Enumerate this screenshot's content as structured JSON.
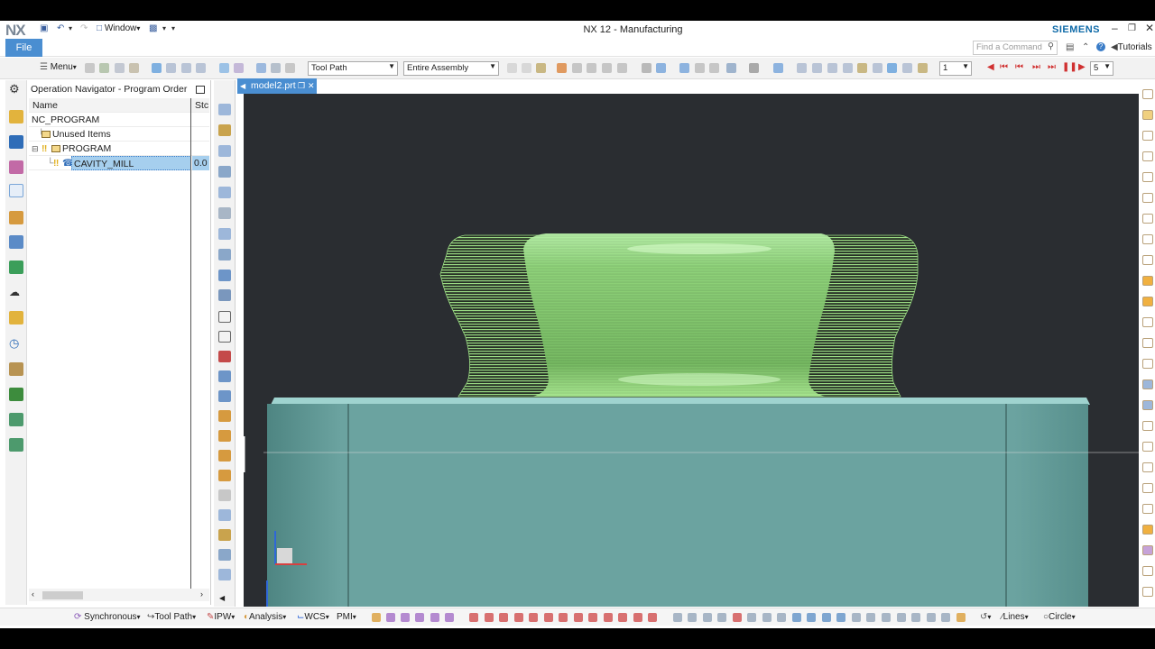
{
  "titlebar": {
    "logo": "NX",
    "window_menu": "Window",
    "title": "NX 12 - Manufacturing",
    "brand": "SIEMENS"
  },
  "ribbon": {
    "file_tab": "File",
    "find_placeholder": "Find a Command",
    "tutorials": "Tutorials"
  },
  "toolbar": {
    "menu_label": "Menu",
    "type_filter": "Tool Path",
    "scope_filter": "Entire Assembly",
    "step_value": "1",
    "speed_value": "5"
  },
  "navigator": {
    "title": "Operation Navigator - Program Order",
    "columns": {
      "name": "Name",
      "status": "Stc"
    },
    "rows": [
      {
        "label": "NC_PROGRAM",
        "status": ""
      },
      {
        "label": "Unused Items",
        "status": ""
      },
      {
        "label": "PROGRAM",
        "status": ""
      },
      {
        "label": "CAVITY_MILL",
        "status": "0.0"
      }
    ]
  },
  "document": {
    "tab": "model2.prt"
  },
  "bottombar": {
    "synchronous": "Synchronous",
    "tool_path": "Tool Path",
    "ipw": "IPW",
    "analysis": "Analysis",
    "wcs": "WCS",
    "pmi": "PMI",
    "lines": "Lines",
    "circle": "Circle"
  },
  "colors": {
    "accent_blue": "#4a8ed1",
    "selection_blue": "#a6cfee",
    "block_teal": "#6ba3a0",
    "toolpath_green": "#8fce78",
    "viewport_bg": "#2a2d31"
  }
}
